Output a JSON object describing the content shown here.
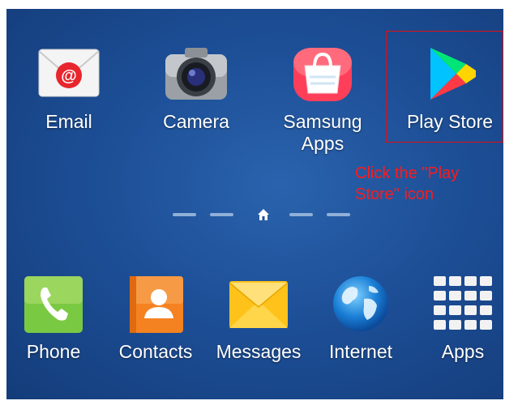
{
  "top_apps": [
    {
      "name": "email",
      "label": "Email",
      "icon": "email-icon"
    },
    {
      "name": "camera",
      "label": "Camera",
      "icon": "camera-icon"
    },
    {
      "name": "samsung-apps",
      "label": "Samsung Apps",
      "icon": "samsung-apps-icon"
    },
    {
      "name": "play-store",
      "label": "Play Store",
      "icon": "play-store-icon"
    }
  ],
  "instruction": "Click the \"Play Store\" icon",
  "page_indicator": {
    "pages": 5,
    "home_index": 2,
    "icon": "home-icon"
  },
  "dock_apps": [
    {
      "name": "phone",
      "label": "Phone",
      "icon": "phone-icon"
    },
    {
      "name": "contacts",
      "label": "Contacts",
      "icon": "contacts-icon"
    },
    {
      "name": "messages",
      "label": "Messages",
      "icon": "messages-icon"
    },
    {
      "name": "internet",
      "label": "Internet",
      "icon": "globe-icon"
    },
    {
      "name": "apps",
      "label": "Apps",
      "icon": "apps-grid-icon"
    }
  ],
  "colors": {
    "wallpaper": "#1d4f97",
    "highlight": "#e01010",
    "instruction_text": "#ff1a1a"
  }
}
